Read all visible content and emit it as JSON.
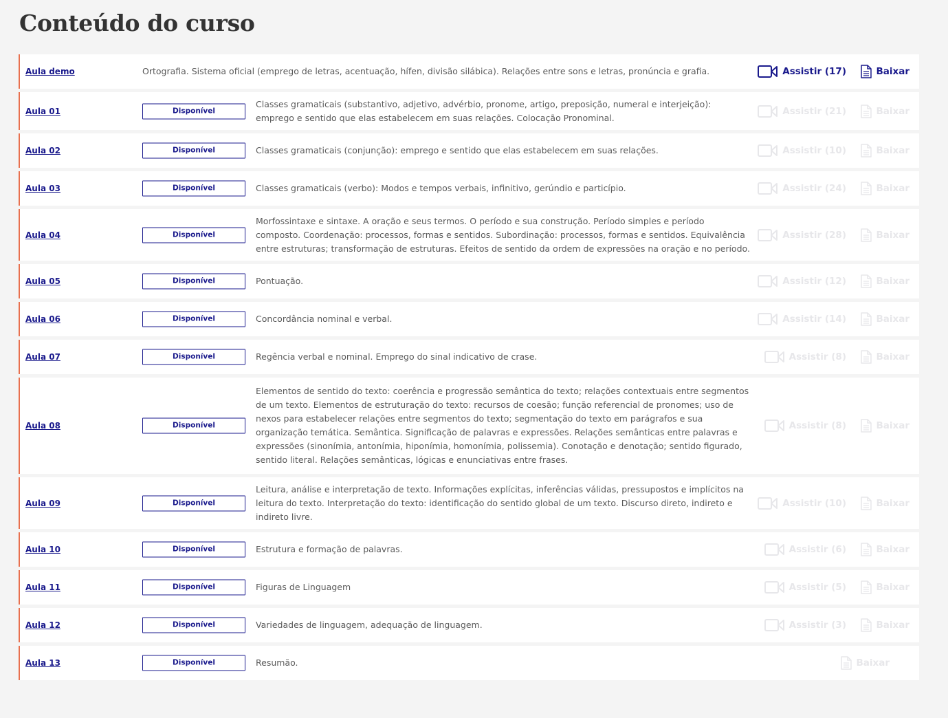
{
  "page": {
    "title": "Conteúdo do curso"
  },
  "colors": {
    "accent": "#1a1a8c",
    "row_border": "#e8704e",
    "disabled": "#e7e7ea"
  },
  "lessons": [
    {
      "name": "Aula demo",
      "status": "",
      "desc": "Ortografia. Sistema oficial (emprego de letras, acentuação, hífen, divisão silábica). Relações entre sons e letras, pronúncia e grafia.",
      "watch": "Assistir (17)",
      "download": "Baixar",
      "enabled": true
    },
    {
      "name": "Aula 01",
      "status": "Disponível",
      "desc": "Classes gramaticais (substantivo, adjetivo, advérbio, pronome, artigo, preposição, numeral e interjeição): emprego e sentido que elas estabelecem em suas relações. Colocação Pronominal.",
      "watch": "Assistir (21)",
      "download": "Baixar",
      "enabled": false
    },
    {
      "name": "Aula 02",
      "status": "Disponível",
      "desc": "Classes gramaticais (conjunção): emprego e sentido que elas estabelecem em suas relações.",
      "watch": "Assistir (10)",
      "download": "Baixar",
      "enabled": false
    },
    {
      "name": "Aula 03",
      "status": "Disponível",
      "desc": "Classes gramaticais (verbo): Modos e tempos verbais, infinitivo, gerúndio e particípio.",
      "watch": "Assistir (24)",
      "download": "Baixar",
      "enabled": false
    },
    {
      "name": "Aula 04",
      "status": "Disponível",
      "desc": "Morfossintaxe e sintaxe. A oração e seus termos. O período e sua construção. Período simples e período composto. Coordenação: processos, formas e sentidos. Subordinação: processos, formas e sentidos. Equivalência entre estruturas; transformação de estruturas. Efeitos de sentido da ordem de expressões na oração e no período.",
      "watch": "Assistir (28)",
      "download": "Baixar",
      "enabled": false
    },
    {
      "name": "Aula 05",
      "status": "Disponível",
      "desc": "Pontuação.",
      "watch": "Assistir (12)",
      "download": "Baixar",
      "enabled": false
    },
    {
      "name": "Aula 06",
      "status": "Disponível",
      "desc": "Concordância nominal e verbal.",
      "watch": "Assistir (14)",
      "download": "Baixar",
      "enabled": false
    },
    {
      "name": "Aula 07",
      "status": "Disponível",
      "desc": "Regência verbal e nominal. Emprego do sinal indicativo de crase.",
      "watch": "Assistir (8)",
      "download": "Baixar",
      "enabled": false
    },
    {
      "name": "Aula 08",
      "status": "Disponível",
      "desc": "Elementos de sentido do texto: coerência e progressão semântica do texto; relações contextuais entre segmentos de um texto. Elementos de estruturação do texto: recursos de coesão; função referencial de pronomes; uso de nexos para estabelecer relações entre segmentos do texto; segmentação do texto em parágrafos e sua organização temática. Semântica. Significação de palavras e expressões. Relações semânticas entre palavras e expressões (sinonímia, antonímia, hiponímia, homonímia, polissemia). Conotação e denotação; sentido figurado, sentido literal. Relações semânticas, lógicas e enunciativas entre frases.",
      "watch": "Assistir (8)",
      "download": "Baixar",
      "enabled": false
    },
    {
      "name": "Aula 09",
      "status": "Disponível",
      "desc": "Leitura, análise e interpretação de texto. Informações explícitas, inferências válidas, pressupostos e implícitos na leitura do texto. Interpretação do texto: identificação do sentido global de um texto. Discurso direto, indireto e indireto livre.",
      "watch": "Assistir (10)",
      "download": "Baixar",
      "enabled": false
    },
    {
      "name": "Aula 10",
      "status": "Disponível",
      "desc": "Estrutura e formação de palavras.",
      "watch": "Assistir (6)",
      "download": "Baixar",
      "enabled": false
    },
    {
      "name": "Aula 11",
      "status": "Disponível",
      "desc": "Figuras de Linguagem",
      "watch": "Assistir (5)",
      "download": "Baixar",
      "enabled": false
    },
    {
      "name": "Aula 12",
      "status": "Disponível",
      "desc": "Variedades de linguagem, adequação de linguagem.",
      "watch": "Assistir (3)",
      "download": "Baixar",
      "enabled": false
    },
    {
      "name": "Aula 13",
      "status": "Disponível",
      "desc": "Resumão.",
      "watch": "",
      "download": "Baixar",
      "enabled": false
    }
  ]
}
